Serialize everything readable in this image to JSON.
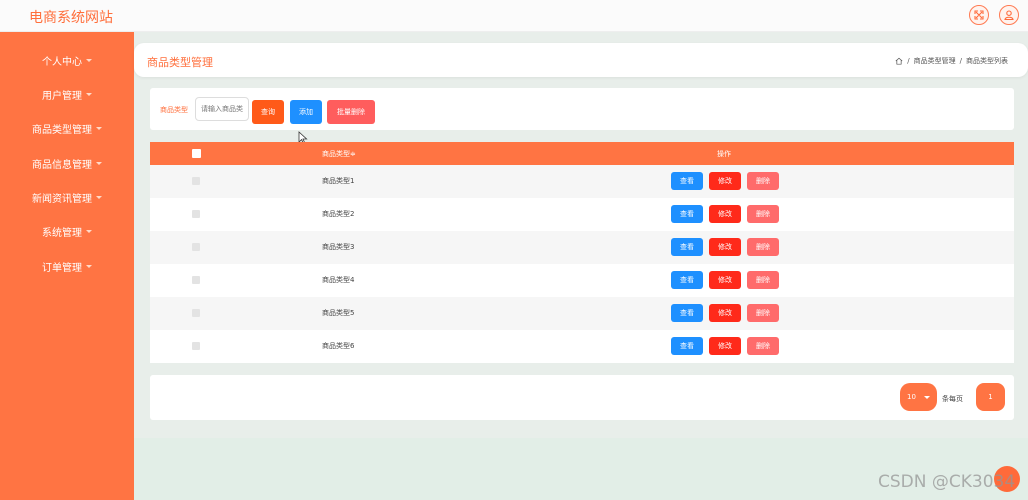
{
  "site": {
    "title": "电商系统网站"
  },
  "sidebar": {
    "items": [
      {
        "label": "个人中心"
      },
      {
        "label": "用户管理"
      },
      {
        "label": "商品类型管理"
      },
      {
        "label": "商品信息管理"
      },
      {
        "label": "新闻资讯管理"
      },
      {
        "label": "系统管理"
      },
      {
        "label": "订单管理"
      }
    ]
  },
  "header": {
    "title": "商品类型管理",
    "breadcrumb": {
      "sep": "/",
      "level1": "商品类型管理",
      "level2": "商品类型列表"
    }
  },
  "search": {
    "label": "商品类型",
    "placeholder": "请输入商品类型",
    "query_label": "查询",
    "add_label": "添加",
    "batch_delete_label": "批量删除"
  },
  "table": {
    "columns": {
      "type": "商品类型",
      "sort_mark": "≑",
      "actions": "操作"
    },
    "actions": {
      "view": "查看",
      "edit": "修改",
      "delete": "删除"
    },
    "rows": [
      {
        "type": "商品类型1"
      },
      {
        "type": "商品类型2"
      },
      {
        "type": "商品类型3"
      },
      {
        "type": "商品类型4"
      },
      {
        "type": "商品类型5"
      },
      {
        "type": "商品类型6"
      }
    ]
  },
  "pagination": {
    "page_size": "10",
    "per_page_label": "条每页",
    "current_page": "1"
  },
  "watermark": "CSDN @CK3034",
  "colors": {
    "accent": "#ff7443",
    "primary_blue": "#1e90ff",
    "danger": "#ff2a1a"
  }
}
